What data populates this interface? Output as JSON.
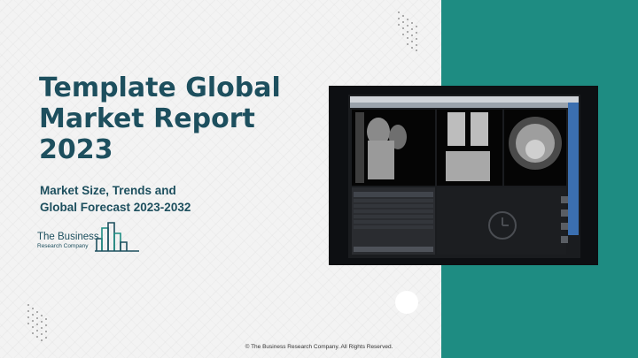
{
  "title": "Template Global Market Report 2023",
  "subtitle": {
    "line1": "Market Size, Trends and",
    "line2": "Global Forecast 2023-2032"
  },
  "logo": {
    "line1": "The Business",
    "line2": "Research Company"
  },
  "footer": "© The Business Research Company. All Rights Reserved.",
  "colors": {
    "title": "#1d4f5e",
    "teal_panel": "#1e8c82",
    "background": "#f3f3f3",
    "logo_accent": "#1e8c82"
  },
  "image": {
    "subject": "monitor-showing-knee-mri-scans"
  }
}
